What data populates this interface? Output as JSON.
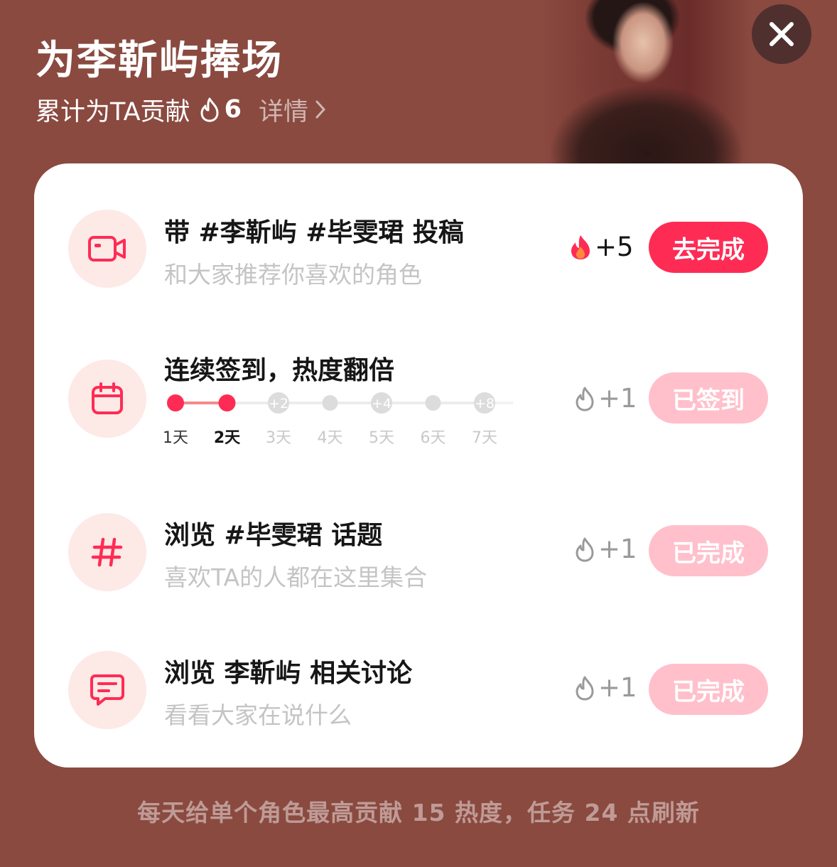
{
  "header": {
    "title": "为李靳屿捧场",
    "contribution_label": "累计为TA贡献",
    "contribution_count": "6",
    "detail_link": "详情"
  },
  "tasks": [
    {
      "title": "带 #李靳屿 #毕雯珺 投稿",
      "subtitle": "和大家推荐你喜欢的角色",
      "reward": "+5",
      "button": "去完成",
      "icon": "video-camera-icon"
    },
    {
      "title": "连续签到，热度翻倍",
      "reward": "+1",
      "button": "已签到",
      "icon": "calendar-icon",
      "streak": {
        "nodes": [
          "",
          "",
          "+2",
          "",
          "+4",
          "",
          "+8"
        ],
        "days": [
          "1天",
          "2天",
          "3天",
          "4天",
          "5天",
          "6天",
          "7天"
        ],
        "completed_days": 2
      }
    },
    {
      "title": "浏览 #毕雯珺 话题",
      "subtitle": "喜欢TA的人都在这里集合",
      "reward": "+1",
      "button": "已完成",
      "icon": "hashtag-icon"
    },
    {
      "title": "浏览 李靳屿 相关讨论",
      "subtitle": "看看大家在说什么",
      "reward": "+1",
      "button": "已完成",
      "icon": "chat-bubble-icon"
    }
  ],
  "footer": {
    "note": "每天给单个角色最高贡献 15 热度，任务 24 点刷新"
  },
  "colors": {
    "background": "#8a4a40",
    "accent": "#fe2c55",
    "done_button": "#ffc0cb",
    "icon_bg": "#fde9e6"
  }
}
